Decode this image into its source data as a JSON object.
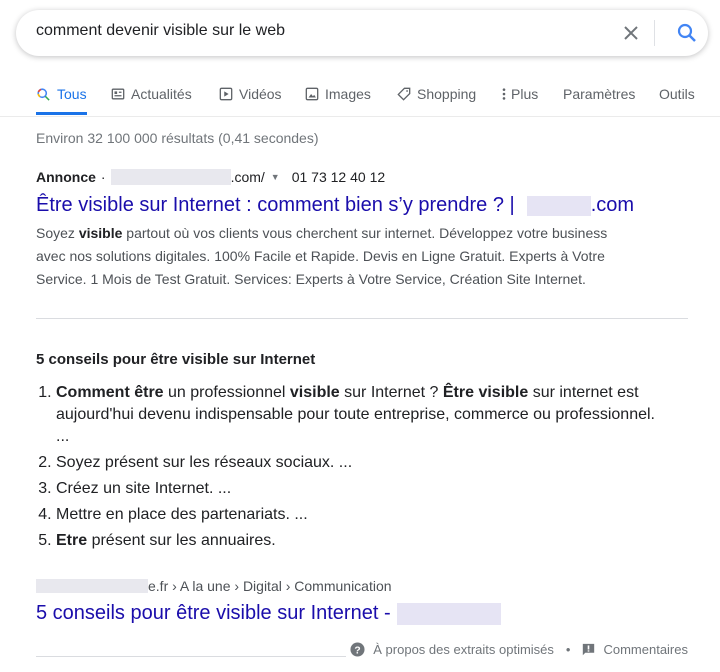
{
  "search": {
    "query": "comment devenir visible sur le web"
  },
  "tabs": [
    {
      "label": "Tous",
      "icon": "search-icon",
      "active": true
    },
    {
      "label": "Actualités",
      "icon": "news-icon"
    },
    {
      "label": "Vidéos",
      "icon": "play-icon"
    },
    {
      "label": "Images",
      "icon": "image-icon"
    },
    {
      "label": "Shopping",
      "icon": "tag-icon"
    },
    {
      "label": "Plus",
      "icon": "more-vert-icon"
    },
    {
      "label": "Paramètres"
    },
    {
      "label": "Outils"
    }
  ],
  "stats": "Environ 32 100 000 résultats (0,41 secondes)",
  "ad": {
    "label": "Annonce",
    "sep": "·",
    "domain_suffix": ".com/",
    "phone": "01 73 12 40 12",
    "title": "Être visible sur Internet : comment bien s’y prendre ? |",
    "title_suffix": ".com",
    "desc_pre": "Soyez ",
    "desc_bold": "visible",
    "desc_post": " partout où vos clients vous cherchent sur internet. Développez votre business avec nos solutions digitales. 100% Facile et Rapide. Devis en Ligne Gratuit. Experts à Votre Service. 1 Mois de Test Gratuit. Services: Experts à Votre Service, Création Site Internet."
  },
  "snippet": {
    "title": "5 conseils pour être visible sur Internet",
    "item1": {
      "b1": "Comment être",
      "t1": " un professionnel ",
      "b2": "visible",
      "t2": " sur Internet ? ",
      "b3": "Être visible",
      "t3": " sur internet est aujourd'hui devenu indispensable pour toute entreprise, commerce ou professionnel. ..."
    },
    "item2": "Soyez présent sur les réseaux sociaux. ...",
    "item3": "Créez un site Internet. ...",
    "item4": "Mettre en place des partenariats. ...",
    "item5_bold": "Etre",
    "item5": " présent sur les annuaires.",
    "breadcrumb": "e.fr › A la une › Digital › Communication",
    "result_title": "5 conseils pour être visible sur Internet -",
    "about": "À propos des extraits optimisés",
    "dot": "•",
    "feedback": "Commentaires"
  }
}
